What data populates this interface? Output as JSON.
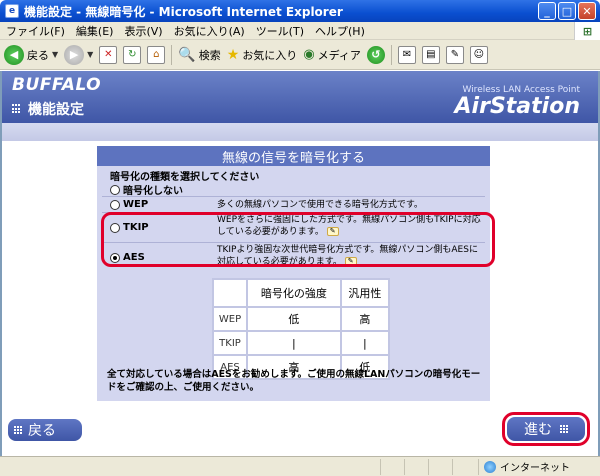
{
  "window": {
    "title": "機能設定 - 無線暗号化 - Microsoft Internet Explorer",
    "minimize": "_",
    "maximize": "□",
    "close": "✕"
  },
  "menubar": {
    "items": [
      "ファイル(F)",
      "編集(E)",
      "表示(V)",
      "お気に入り(A)",
      "ツール(T)",
      "ヘルプ(H)"
    ]
  },
  "toolbar": {
    "back": "戻る",
    "search": "検索",
    "favorites": "お気に入り",
    "media": "メディア"
  },
  "header": {
    "logo": "BUFFALO",
    "page_title": "機能設定",
    "brand_tag": "Wireless LAN Access Point",
    "brand_name": "AirStation"
  },
  "panel": {
    "title": "無線の信号を暗号化する",
    "instruction": "暗号化の種類を選択してください",
    "options": [
      {
        "label": "暗号化しない",
        "checked": false,
        "desc": ""
      },
      {
        "label": "WEP",
        "checked": false,
        "desc": "多くの無線パソコンで使用できる暗号化方式です。"
      },
      {
        "label": "TKIP",
        "checked": false,
        "desc": "WEPをさらに強固にした方式です。無線パソコン側もTKIPに対応している必要があります。"
      },
      {
        "label": "AES",
        "checked": true,
        "desc": "TKIPより強固な次世代暗号化方式です。無線パソコン側もAESに対応している必要があります。"
      }
    ],
    "table": {
      "headers": [
        "",
        "暗号化の強度",
        "汎用性"
      ],
      "rows": [
        [
          "WEP",
          "低",
          "高"
        ],
        [
          "TKIP",
          "|",
          "|"
        ],
        [
          "AES",
          "高",
          "低"
        ]
      ]
    },
    "footnote": "全て対応している場合はAESをお勧めします。ご使用の無線LANパソコンの暗号化モードをご確認の上、ご使用ください。"
  },
  "nav": {
    "back": "戻る",
    "next": "進む"
  },
  "status": {
    "zone": "インターネット"
  }
}
